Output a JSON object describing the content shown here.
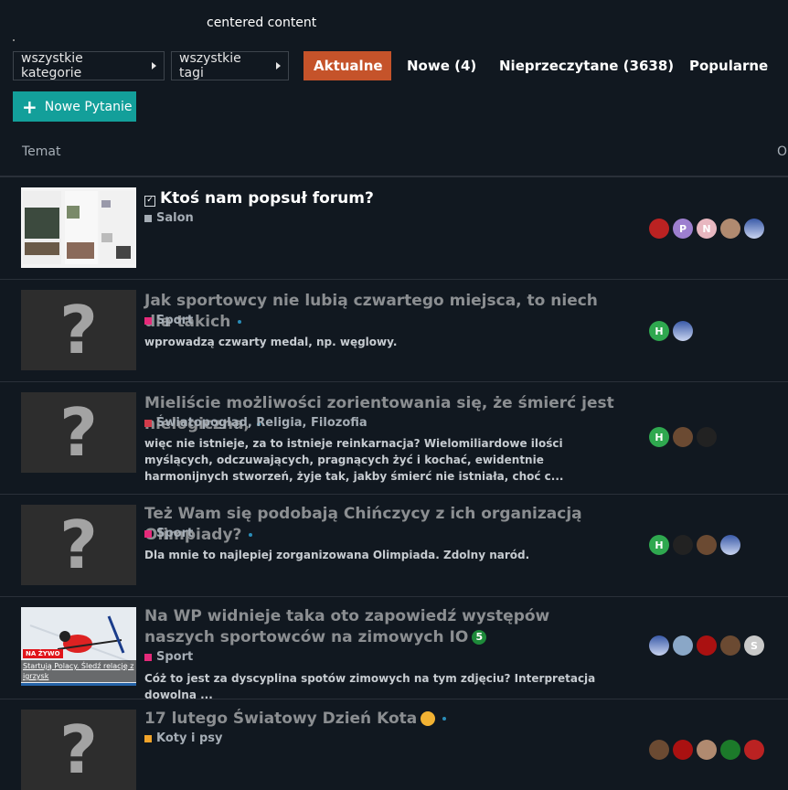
{
  "page": {
    "centered_text": "centered content"
  },
  "filters": {
    "categories_label": "wszystkie kategorie",
    "tags_label": "wszystkie tagi"
  },
  "tabs": [
    {
      "label": "Aktualne",
      "active": true
    },
    {
      "label": "Nowe (4)",
      "active": false
    },
    {
      "label": "Nieprzeczytane (3638)",
      "active": false
    },
    {
      "label": "Popularne",
      "active": false
    }
  ],
  "new_question_label": "Nowe Pytanie",
  "table": {
    "col_topic": "Temat",
    "col_other": "O"
  },
  "topics": [
    {
      "title": "Ktoś nam popsuł forum?",
      "category": "Salon",
      "category_color": "#a5adb5",
      "excerpt": "",
      "avatars": [
        "img-red",
        "P",
        "N",
        "img-tan",
        "img-blue"
      ]
    },
    {
      "title": "Jak sportowcy nie lubią czwartego miejsca, to niech dla takich",
      "category": "Sport",
      "category_color": "#e52a7a",
      "excerpt": "wprowadzą czwarty medal, np. węglowy.",
      "avatars": [
        "H",
        "img-blue"
      ]
    },
    {
      "title": "Mieliście możliwości zorientowania się, że śmierć jest nielogiczna,",
      "category": "Światopogląd, Religia, Filozofia",
      "category_color": "#d13b4a",
      "excerpt": "więc nie istnieje, za to istnieje reinkarnacja? Wielomiliardowe ilości myślących, odczuwających, pragnących żyć i kochać, ewidentnie harmonijnych stworzeń, żyje tak, jakby śmierć nie istniała, choć c...",
      "avatars": [
        "H",
        "img-cat",
        "img-dark"
      ]
    },
    {
      "title": "Też Wam się podobają Chińczycy z ich organizacją Olimpiady?",
      "category": "Sport",
      "category_color": "#e52a7a",
      "excerpt": "Dla mnie to najlepiej zorganizowana Olimpiada. Zdolny naród.",
      "avatars": [
        "H",
        "img-dark",
        "img-cat",
        "img-blue"
      ]
    },
    {
      "title": "Na WP widnieje taka oto zapowiedź występów naszych sportowców na zimowych IO",
      "badge": "5",
      "category": "Sport",
      "category_color": "#e52a7a",
      "excerpt": "Cóż to jest za dyscyplina spotów zimowych na tym zdjęciu? Interpretacja dowolna ...",
      "avatars": [
        "img-blue",
        "img-sky",
        "img-red2",
        "img-cat",
        "S"
      ],
      "thumb_caption_1": "NA ŻYWO",
      "thumb_caption_2": "Startują Polacy. Śledź relację z",
      "thumb_caption_3": "igrzysk"
    },
    {
      "title": "17 lutego Światowy Dzień Kota",
      "category": "Koty i psy",
      "category_color": "#f0a32a",
      "excerpt": "",
      "avatars": [
        "img-cat",
        "img-red2",
        "img-tan",
        "img-green",
        "img-red"
      ]
    }
  ],
  "colors": {
    "accent": "#c5532a",
    "teal": "#139f9a",
    "background": "#111820"
  }
}
